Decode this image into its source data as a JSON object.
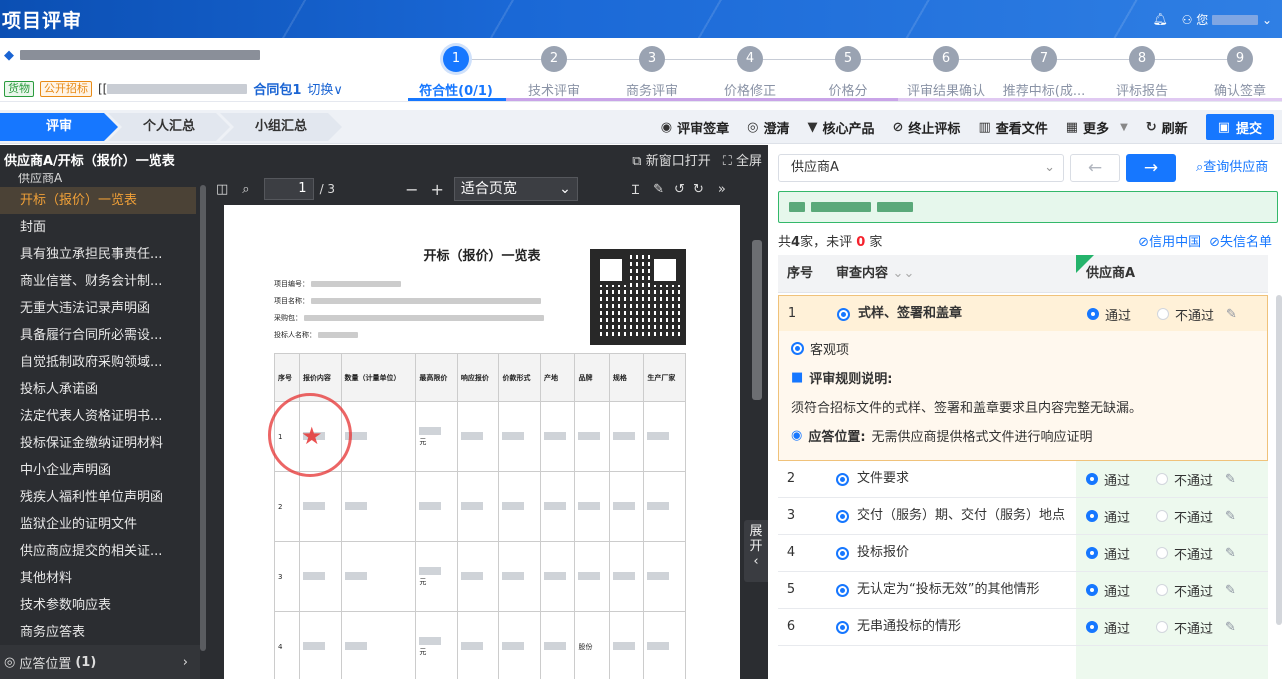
{
  "header": {
    "title": "项目评审",
    "user": "您"
  },
  "project": {
    "tags": [
      "货物",
      "公开招标"
    ],
    "package": "合同包1",
    "switch": "切换∨"
  },
  "steps": [
    {
      "num": "1",
      "label": "符合性(0/1)",
      "active": true
    },
    {
      "num": "2",
      "label": "技术评审"
    },
    {
      "num": "3",
      "label": "商务评审"
    },
    {
      "num": "4",
      "label": "价格修正"
    },
    {
      "num": "5",
      "label": "价格分"
    },
    {
      "num": "6",
      "label": "评审结果确认"
    },
    {
      "num": "7",
      "label": "推荐中标(成..."
    },
    {
      "num": "8",
      "label": "评标报告"
    },
    {
      "num": "9",
      "label": "确认签章"
    }
  ],
  "tabs": [
    "评审",
    "个人汇总",
    "小组汇总"
  ],
  "actions": [
    "评审签章",
    "澄清",
    "核心产品",
    "终止评标",
    "查看文件",
    "更多",
    "刷新",
    "提交"
  ],
  "left": {
    "title": "供应商A/开标（报价）一览表",
    "new_window": "新窗口打开",
    "fullscreen": "全屏",
    "supplier": "供应商A",
    "files": [
      "开标（报价）一览表",
      "封面",
      "具有独立承担民事责任...",
      "商业信誉、财务会计制...",
      "无重大违法记录声明函",
      "具备履行合同所必需设...",
      "自觉抵制政府采购领域...",
      "投标人承诺函",
      "法定代表人资格证明书...",
      "投标保证金缴纳证明材料",
      "中小企业声明函",
      "残疾人福利性单位声明函",
      "监狱企业的证明文件",
      "供应商应提交的相关证...",
      "其他材料",
      "技术参数响应表",
      "商务应答表"
    ],
    "footer": "应答位置",
    "footer_count": "(1)",
    "page": "1",
    "page_total": "/ 3",
    "zoom": "适合页宽",
    "expand": "展开"
  },
  "pdf": {
    "title": "开标（报价）一览表",
    "meta": [
      "项目编号：",
      "项目名称：",
      "采购包：",
      "投标人名称："
    ],
    "headers": [
      "序号",
      "报价内容",
      "数量（计量单位）",
      "最高限价",
      "响应报价",
      "价款形式",
      "产地",
      "品牌",
      "规格",
      "生产厂家"
    ],
    "rows": [
      "1",
      "2",
      "3",
      "4"
    ],
    "r1_price": "元",
    "r3_price": "元",
    "r4_price": "元",
    "r4_brand": "股份"
  },
  "right": {
    "supplier_select": "供应商A",
    "query": "查询供应商",
    "counts": {
      "prefix": "共",
      "total": "4",
      "mid": "家，未评",
      "unrated": "0",
      "suffix": "家"
    },
    "links": [
      "信用中国",
      "失信名单"
    ],
    "columns": [
      "序号",
      "审查内容",
      "供应商A"
    ],
    "rows": [
      {
        "no": "1",
        "item": "式样、签署和盖章"
      },
      {
        "no": "2",
        "item": "文件要求"
      },
      {
        "no": "3",
        "item": "交付（服务）期、交付（服务）地点"
      },
      {
        "no": "4",
        "item": "投标报价"
      },
      {
        "no": "5",
        "item": "无认定为“投标无效”的其他情形"
      },
      {
        "no": "6",
        "item": "无串通投标的情形"
      }
    ],
    "pass": "通过",
    "fail": "不通过",
    "detail": {
      "type": "客观项",
      "rule_title": "评审规则说明:",
      "rule_text": "须符合招标文件的式样、签署和盖章要求且内容完整无缺漏。",
      "answer_label": "应答位置:",
      "answer_text": "无需供应商提供格式文件进行响应证明"
    }
  },
  "colors": {
    "primary": "#1677ff",
    "active_file": "#f0a038",
    "pass_bg": "#edf9ee",
    "highlight": "#fff1d8"
  }
}
